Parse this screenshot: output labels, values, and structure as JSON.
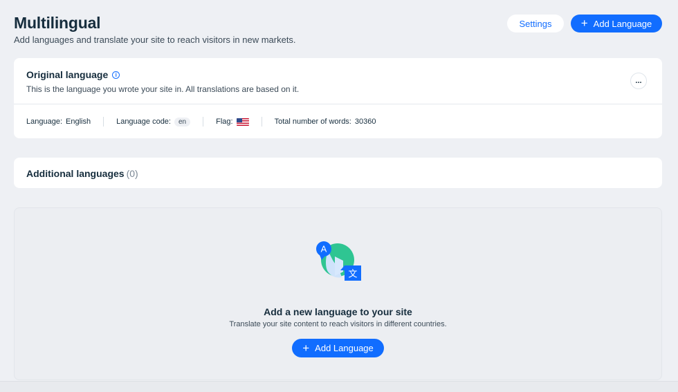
{
  "header": {
    "title": "Multilingual",
    "subtitle": "Add languages and translate your site to reach visitors in new markets.",
    "settings_label": "Settings",
    "add_language_label": "Add Language"
  },
  "original_language": {
    "title": "Original language",
    "description": "This is the language you wrote your site in. All translations are based on it.",
    "more_label": "...",
    "language_label": "Language:",
    "language_value": "English",
    "code_label": "Language code:",
    "code_value": "en",
    "flag_label": "Flag:",
    "flag_icon": "us-flag-icon",
    "words_label": "Total number of words:",
    "words_value": "30360"
  },
  "additional_languages": {
    "title": "Additional languages",
    "count": "(0)"
  },
  "empty_state": {
    "title": "Add a new language to your site",
    "description": "Translate your site content to reach visitors in different countries.",
    "button_label": "Add Language",
    "illustration_letter_a": "A",
    "illustration_letter_wen": "文"
  },
  "colors": {
    "accent": "#116dff",
    "background": "#eef0f4",
    "illustration_green": "#2fc592"
  }
}
